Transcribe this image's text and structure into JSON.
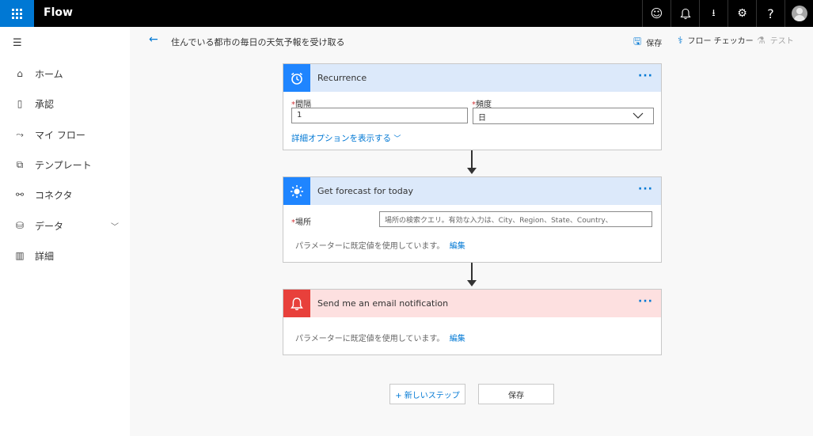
{
  "app": {
    "title": "Flow"
  },
  "topbar_icons": [
    "smiley-icon",
    "bell-icon",
    "download-icon",
    "gear-icon",
    "help-icon",
    "avatar"
  ],
  "sidebar": {
    "items": [
      {
        "label": "ホーム",
        "icon": "home-icon"
      },
      {
        "label": "承認",
        "icon": "approval-icon"
      },
      {
        "label": "マイ フロー",
        "icon": "flow-icon"
      },
      {
        "label": "テンプレート",
        "icon": "template-icon"
      },
      {
        "label": "コネクタ",
        "icon": "connector-icon"
      },
      {
        "label": "データ",
        "icon": "database-icon"
      },
      {
        "label": "詳細",
        "icon": "book-icon"
      }
    ]
  },
  "cmdbar": {
    "flow_name": "住んでいる都市の毎日の天気予報を受け取る",
    "save_label": "保存",
    "checker_label": "フロー チェッカー",
    "test_label": "テスト"
  },
  "recurrence": {
    "title": "Recurrence",
    "interval_label": "間隔",
    "interval_value": "1",
    "frequency_label": "頻度",
    "frequency_value": "日",
    "advanced_link": "詳細オプションを表示する"
  },
  "forecast": {
    "title": "Get forecast for today",
    "location_label": "場所",
    "location_placeholder": "場所の検索クエリ。有効な入力は、City、Region、State、Country、",
    "default_note": "パラメーターに既定値を使用しています。",
    "edit_link": "編集"
  },
  "email": {
    "title": "Send me an email notification",
    "default_note": "パラメーターに既定値を使用しています。",
    "edit_link": "編集"
  },
  "bottom": {
    "new_step_label": "+ 新しいステップ",
    "save_label": "保存"
  },
  "colors": {
    "accent": "#0078d4",
    "recurrence_header": "#dce9fa",
    "forecast_header": "#dce9fa",
    "email_header": "#fde0e0",
    "email_icon_bg": "#e8403b"
  }
}
